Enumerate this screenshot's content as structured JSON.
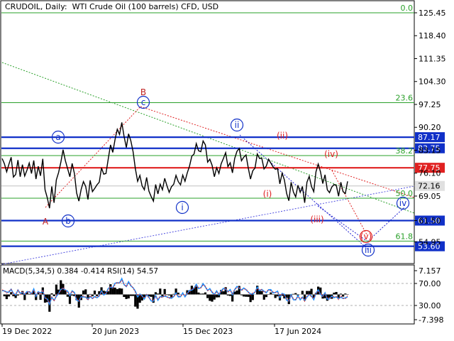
{
  "header": {
    "symbol": "CRUDOIL",
    "timeframe": "Daily:",
    "description": "WTI Crude Oil (100 barrels) CFD, USD"
  },
  "subwindow": {
    "macd_label": "MACD(5,34,5)",
    "macd_main": "0.384",
    "macd_signal": "-0.414",
    "rsi_label": "RSI(14)",
    "rsi_value": "54.57",
    "scale": [
      "7.157",
      "70.00",
      "30.00",
      "-7.398"
    ]
  },
  "chart_data": {
    "type": "line",
    "price_axis": [
      "125.45",
      "118.40",
      "111.35",
      "104.30",
      "97.25",
      "90.20",
      "83.15",
      "76.10",
      "69.05",
      "61.50",
      "54.95"
    ],
    "date_axis": [
      "19 Dec 2022",
      "20 Jun 2023",
      "15 Dec 2023",
      "17 Jun 2024"
    ],
    "current_price": "72.16",
    "support_resistance": [
      {
        "label": "87.17",
        "color": "#1030c8"
      },
      {
        "label": "83.75",
        "color": "#1030c8"
      },
      {
        "label": "77.75",
        "color": "#e02020"
      },
      {
        "label": "61.50",
        "color": "#1030c8"
      },
      {
        "label": "53.60",
        "color": "#1030c8"
      }
    ],
    "fibonacci": [
      {
        "level": "0.0",
        "price": 125.45
      },
      {
        "level": "23.6",
        "price": 97.8
      },
      {
        "level": "38.2",
        "price": 81.5
      },
      {
        "level": "50.0",
        "price": 68.4
      },
      {
        "level": "61.8",
        "price": 55.2
      }
    ],
    "wave_labels": [
      "A",
      "B",
      "a",
      "b",
      "c",
      "i",
      "ii",
      "(i)",
      "(ii)",
      "(iii)",
      "(iv)",
      "(v)",
      "iii",
      "iv"
    ],
    "series": [
      {
        "values": [
          80.6,
          79.0,
          76.5,
          78.8,
          81.0,
          74.9,
          75.7,
          80.1,
          75.0,
          78.7,
          75.2,
          77.0,
          79.2,
          76.0,
          80.0,
          74.3,
          78.2,
          75.3,
          80.5,
          71.0,
          68.5,
          65.3,
          72.0,
          67.0,
          74.0,
          76.3,
          79.5,
          83.3,
          80.0,
          77.5,
          75.0,
          79.1,
          76.0,
          70.0,
          67.5,
          71.1,
          73.5,
          72.0,
          68.0,
          73.9,
          70.4,
          71.4,
          72.5,
          73.3,
          77.7,
          75.8,
          76.0,
          80.5,
          84.8,
          82.5,
          86.5,
          89.6,
          88.0,
          91.7,
          87.4,
          84.0,
          88.2,
          86.1,
          82.7,
          77.5,
          73.6,
          75.4,
          72.2,
          71.0,
          74.8,
          70.6,
          68.9,
          67.5,
          72.6,
          69.7,
          72.7,
          71.0,
          74.5,
          72.2,
          70.2,
          71.9,
          72.7,
          75.4,
          73.5,
          72.5,
          75.5,
          73.6,
          76.2,
          78.3,
          81.3,
          82.0,
          85.2,
          83.0,
          82.7,
          86.0,
          84.8,
          79.5,
          80.4,
          78.5,
          75.0,
          77.8,
          76.0,
          79.0,
          80.6,
          82.4,
          78.1,
          79.3,
          76.2,
          80.6,
          82.8,
          83.7,
          79.9,
          81.0,
          81.7,
          77.8,
          74.3,
          76.8,
          77.7,
          82.0,
          80.6,
          80.7,
          77.4,
          78.3,
          80.4,
          79.2,
          78.0,
          77.3,
          77.5,
          72.8,
          76.1,
          74.0,
          69.8,
          67.6,
          73.3,
          70.3,
          68.8,
          72.4,
          70.2,
          72.0,
          67.0,
          73.3,
          75.1,
          72.0,
          70.4,
          76.5,
          78.9,
          76.5,
          72.9,
          75.6,
          71.0,
          70.1,
          71.8,
          72.6,
          72.3,
          69.0,
          73.3,
          70.4,
          69.8,
          73.6
        ],
        "color": "#000000"
      }
    ]
  }
}
